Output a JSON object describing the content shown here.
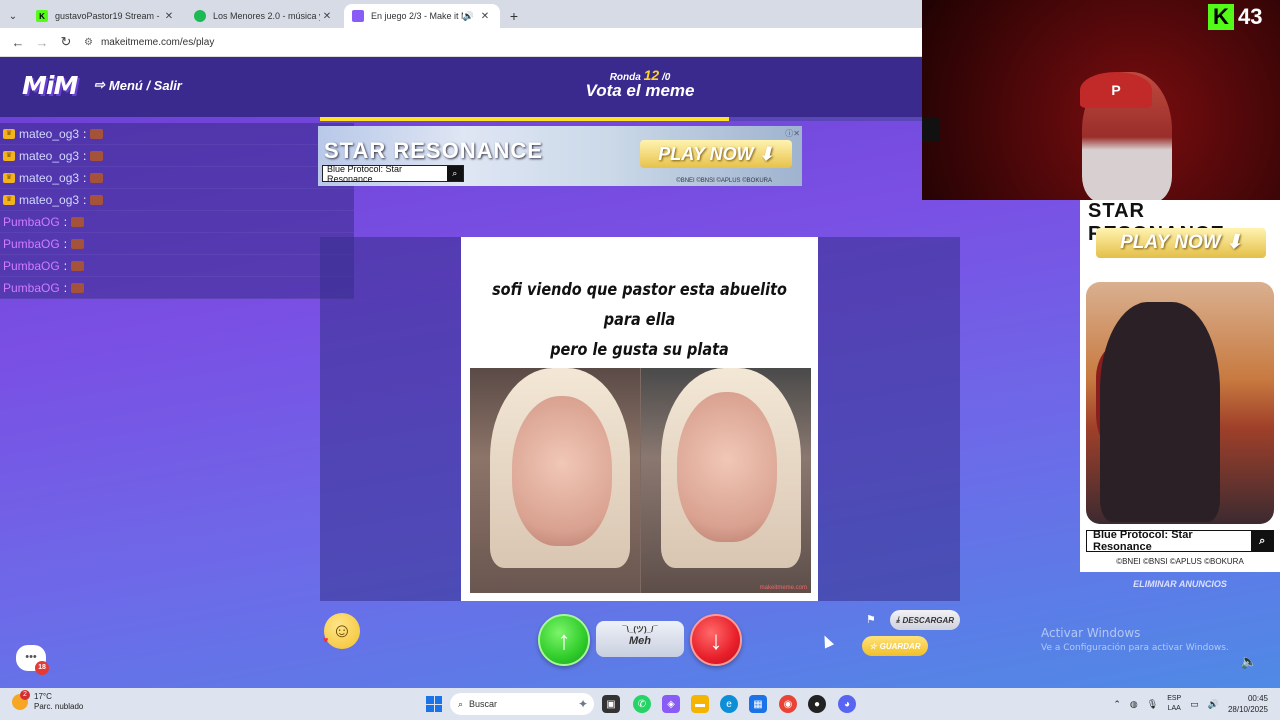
{
  "browser": {
    "tabs": [
      {
        "title": "gustavoPastor19 Stream - Watc",
        "favicon_color": "#53fc18",
        "favicon_letter": "K",
        "active": false
      },
      {
        "title": "Los Menores 2.0 - música y letr",
        "favicon_color": "#1db954",
        "favicon_letter": "",
        "active": false
      },
      {
        "title": "En juego 2/3 - Make it Me",
        "favicon_color": "#8a5cf6",
        "favicon_letter": "",
        "active": true
      }
    ],
    "url": "makeitmeme.com/es/play"
  },
  "header": {
    "logo": "MiM",
    "menu_label": "Menú / Salir",
    "round_label": "Ronda",
    "round_number": "12",
    "round_suffix": "/0",
    "phase_title": "Vota el meme",
    "progress_fraction": 0.68
  },
  "chat": [
    {
      "user": "mateo_og3",
      "type": "crown"
    },
    {
      "user": "mateo_og3",
      "type": "crown"
    },
    {
      "user": "mateo_og3",
      "type": "crown"
    },
    {
      "user": "mateo_og3",
      "type": "crown"
    },
    {
      "user": "PumbaOG",
      "type": "plain"
    },
    {
      "user": "PumbaOG",
      "type": "plain"
    },
    {
      "user": "PumbaOG",
      "type": "plain"
    },
    {
      "user": "PumbaOG",
      "type": "plain"
    }
  ],
  "ad_top": {
    "brand": "STAR RESONANCE",
    "cta": "PLAY NOW ⬇",
    "search_label": "Blue Protocol: Star Resonance",
    "copyright": "©BNEI ©BNSI ©APLUS ©BOKURA"
  },
  "meme": {
    "caption_line1": "sofi viendo que pastor esta abuelito para ella",
    "caption_line2": "pero le gusta su plata",
    "watermark": "makeitmeme.com"
  },
  "ad_right": {
    "brand": "STAR RESONANCE",
    "cta": "PLAY NOW ⬇",
    "search_label": "Blue Protocol: Star Resonance",
    "copyright": "©BNEI ©BNSI ©APLUS ©BOKURA",
    "remove_ads": "ELIMINAR ANUNCIOS"
  },
  "vote": {
    "up_icon": "↑",
    "meh_shrug": "¯\\_(ツ)_/¯",
    "meh_label": "Meh",
    "down_icon": "↓",
    "download_label": "DESCARGAR",
    "save_label": "GUARDAR",
    "chat_badge": "18"
  },
  "windows_watermark": {
    "line1": "Activar Windows",
    "line2": "Ve a Configuración para activar Windows."
  },
  "stream": {
    "viewer_count": "43",
    "k_logo": "K"
  },
  "taskbar": {
    "weather_temp": "17°C",
    "weather_desc": "Parc. nublado",
    "weather_badge": "2",
    "search_placeholder": "Buscar",
    "lang_line1": "ESP",
    "lang_line2": "LAA",
    "time": "00:45",
    "date": "28/10/2025"
  },
  "colors": {
    "accent_yellow": "#ffe227",
    "vote_up": "#2fcc2a",
    "vote_down": "#e81f2a",
    "kick_green": "#53fc18"
  }
}
